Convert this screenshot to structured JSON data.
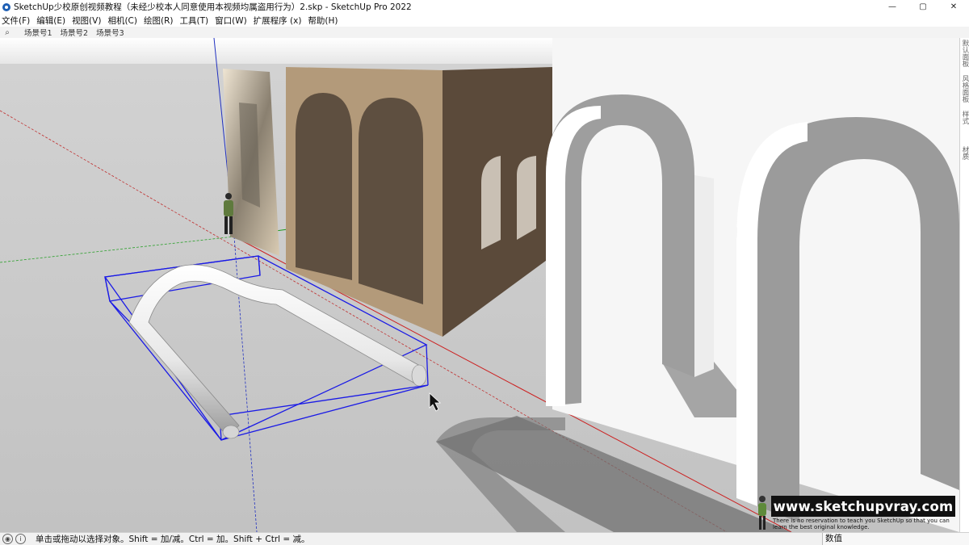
{
  "app": {
    "title": "SketchUp少校原创视频教程（未经少校本人同意使用本视频均属盗用行为）2.skp - SketchUp Pro 2022"
  },
  "window_controls": {
    "minimize": "—",
    "maximize": "▢",
    "close": "✕"
  },
  "menu": [
    "文件(F)",
    "编辑(E)",
    "视图(V)",
    "相机(C)",
    "绘图(R)",
    "工具(T)",
    "窗口(W)",
    "扩展程序 (x)",
    "帮助(H)"
  ],
  "scenes": {
    "search_icon": "search-icon",
    "tabs": [
      "场景号1",
      "场景号2",
      "场景号3"
    ]
  },
  "right_panel_tabs": [
    "默认面板",
    "风格面板",
    "样式",
    "材质"
  ],
  "watermark": {
    "url": "www.sketchupvray.com",
    "sub": "There is no reservation to teach you SketchUp so that you can learn the best original knowledge."
  },
  "status": {
    "message": "单击或拖动以选择对象。Shift = 加/减。Ctrl = 加。Shift + Ctrl = 减。",
    "measurements_label": "数值"
  },
  "colors": {
    "selection": "#1a1ae6",
    "wall_tan": "#b39a7a",
    "wall_dark": "#5b4a3a",
    "ground": "#c6c6c6",
    "sky": "#f2f2f2"
  }
}
